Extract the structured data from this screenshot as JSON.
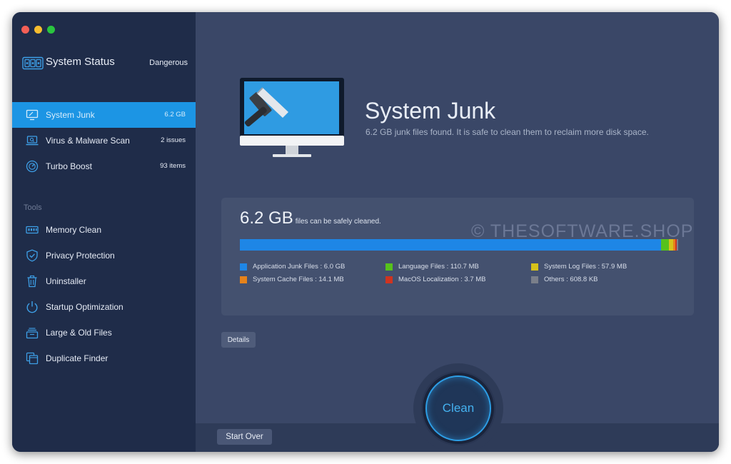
{
  "sidebar": {
    "title": "System Status",
    "status_level": "Dangerous",
    "scan_items": [
      {
        "label": "System Junk",
        "count": "6.2 GB",
        "icon": "monitor-icon"
      },
      {
        "label": "Virus & Malware Scan",
        "count": "2 issues",
        "icon": "laptop-scan-icon"
      },
      {
        "label": "Turbo Boost",
        "count": "93 items",
        "icon": "speedometer-icon"
      }
    ],
    "tools_heading": "Tools",
    "tools": [
      {
        "label": "Memory Clean",
        "icon": "memory-chip-icon"
      },
      {
        "label": "Privacy Protection",
        "icon": "shield-check-icon"
      },
      {
        "label": "Uninstaller",
        "icon": "trash-icon"
      },
      {
        "label": "Startup Optimization",
        "icon": "power-icon"
      },
      {
        "label": "Large & Old Files",
        "icon": "file-stack-icon"
      },
      {
        "label": "Duplicate Finder",
        "icon": "duplicate-folder-icon"
      }
    ]
  },
  "main": {
    "title": "System Junk",
    "subtitle": "6.2 GB junk files found.  It is safe to clean them to reclaim more disk space.",
    "summary": {
      "size": "6.2 GB",
      "caption": "files can be safely cleaned."
    },
    "legend": [
      {
        "label": "Application Junk Files : 6.0 GB",
        "color": "#1e86e6"
      },
      {
        "label": "Language Files : 110.7 MB",
        "color": "#56c21c"
      },
      {
        "label": "System Log Files : 57.9 MB",
        "color": "#d6c21a"
      },
      {
        "label": "System Cache Files : 14.1 MB",
        "color": "#e6821a"
      },
      {
        "label": "MacOS Localization : 3.7 MB",
        "color": "#cf3420"
      },
      {
        "label": "Others : 608.8 KB",
        "color": "#7a7f8a"
      }
    ],
    "details_label": "Details",
    "clean_label": "Clean",
    "start_over_label": "Start Over",
    "watermark": "© THESOFTWARE.SHOP"
  },
  "colors": {
    "accent": "#1c95e4",
    "sidebar_bg": "#1f2c49",
    "main_bg": "#3a4767"
  }
}
